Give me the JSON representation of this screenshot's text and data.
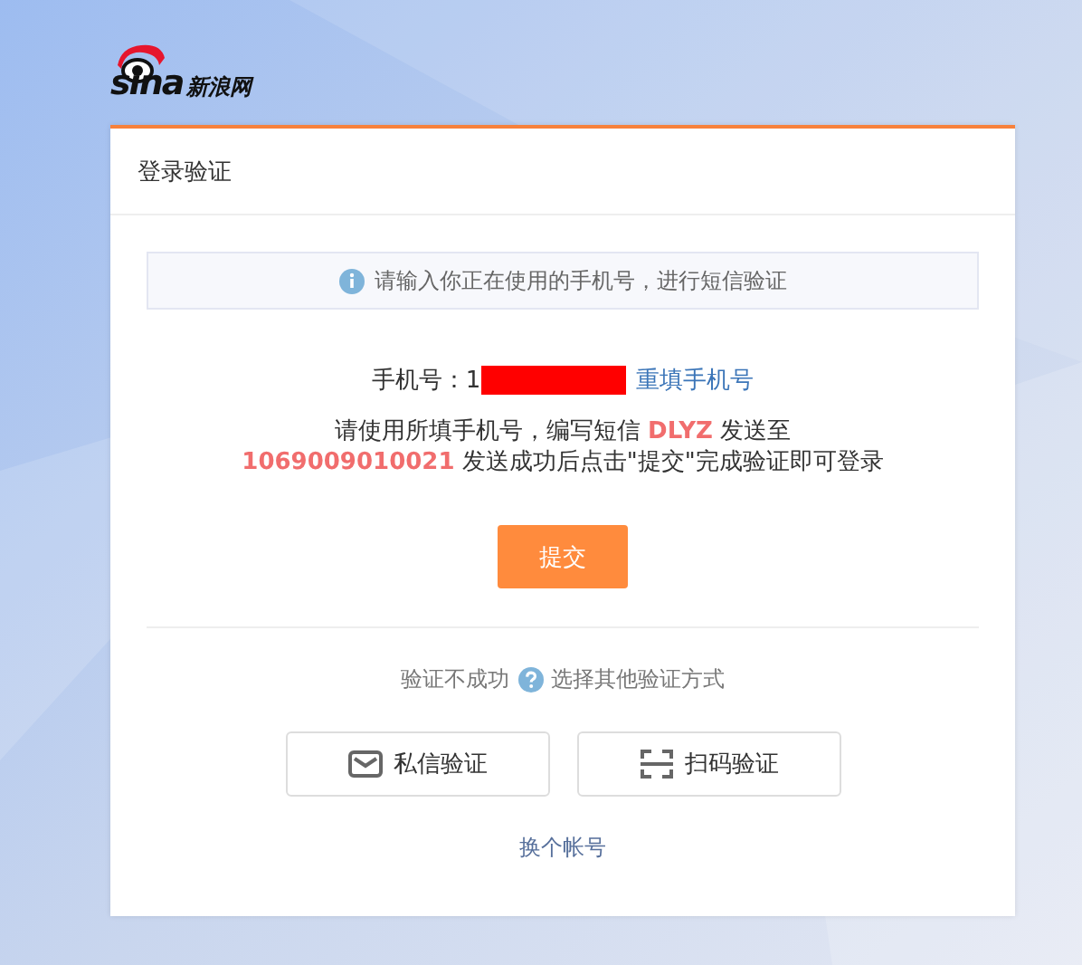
{
  "logo": {
    "wordmark": "sina",
    "name": "新浪网"
  },
  "card": {
    "title": "登录验证"
  },
  "notice": "请输入你正在使用的手机号，进行短信验证",
  "phone": {
    "label": "手机号：",
    "value": "1",
    "redacted": true,
    "refill_link": "重填手机号"
  },
  "instructions": [
    "请使用所填手机号，编写短信 **DLYZ** 发送至",
    "**1069009010021** 发送成功后点击\"提交\"完成验证即可登录"
  ],
  "submit_button": "提交",
  "alternatives": {
    "prefix": "验证不成功",
    "link": "选择其他验证方式"
  },
  "methods": [
    {
      "kind": "message",
      "label": "私信验证"
    },
    {
      "kind": "scan",
      "label": "扫码验证"
    }
  ],
  "switch_account": "换个帐号"
}
